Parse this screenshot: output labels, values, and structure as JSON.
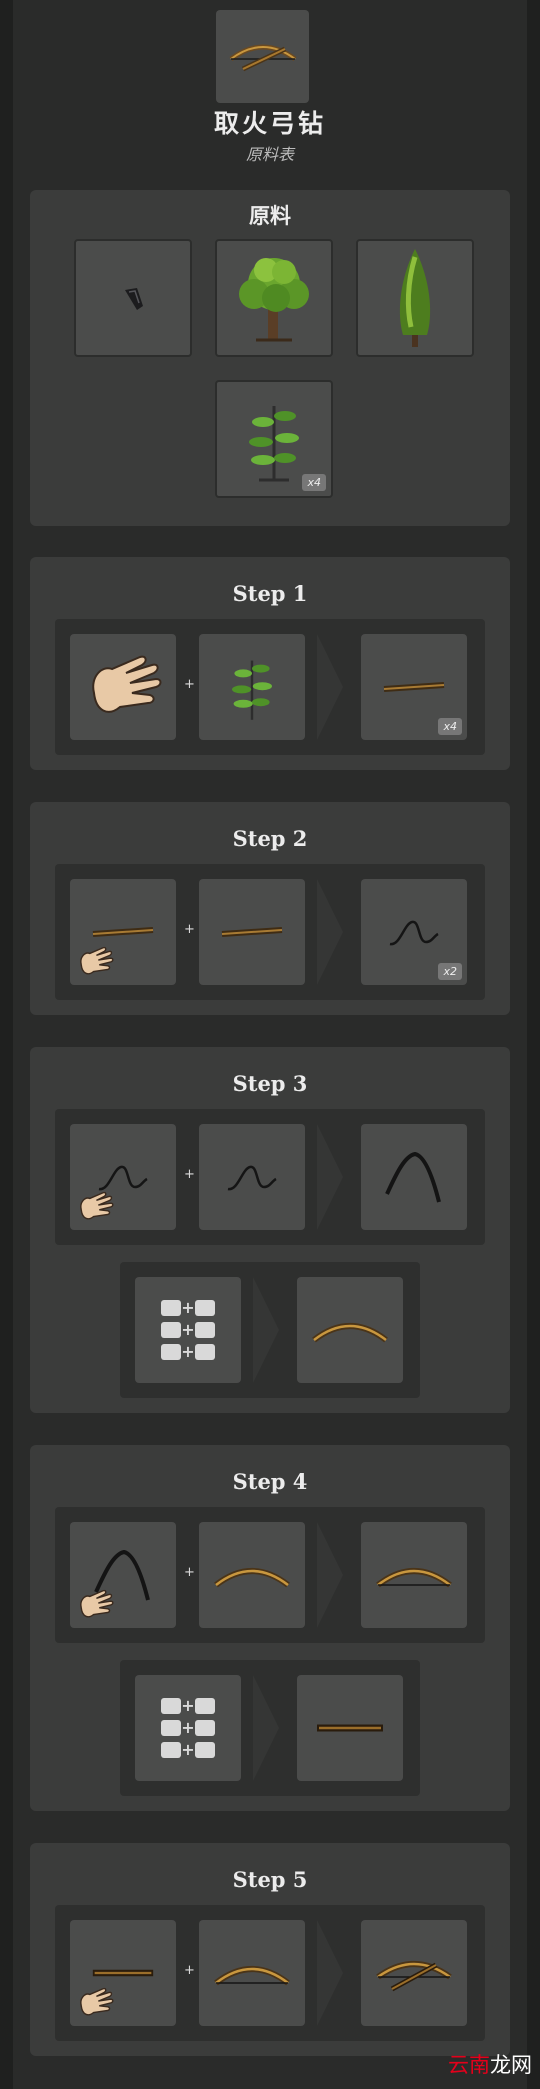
{
  "header": {
    "title": "取火弓钻",
    "subtitle": "原料表"
  },
  "materials": {
    "title": "原料",
    "items": [
      {
        "name": "flint",
        "badge": ""
      },
      {
        "name": "birchnut-tree",
        "badge": ""
      },
      {
        "name": "evergreen-tree",
        "badge": ""
      },
      {
        "name": "sapling",
        "badge": "x4"
      }
    ]
  },
  "steps": [
    {
      "label": "Step 1",
      "rows": [
        {
          "kind": "hand",
          "in1": "hand",
          "in2": "sapling",
          "out": "stick",
          "badge": "x4"
        }
      ]
    },
    {
      "label": "Step 2",
      "rows": [
        {
          "kind": "hand",
          "in1": "stick",
          "in2": "stick",
          "out": "string",
          "badge": "x2"
        }
      ]
    },
    {
      "label": "Step 3",
      "rows": [
        {
          "kind": "hand",
          "in1": "string",
          "in2": "string",
          "out": "bow-string",
          "badge": ""
        },
        {
          "kind": "grid",
          "out": "curved-bow",
          "badge": ""
        }
      ]
    },
    {
      "label": "Step 4",
      "rows": [
        {
          "kind": "hand",
          "in1": "bow-string",
          "in2": "curved-bow",
          "out": "strung-bow",
          "badge": ""
        },
        {
          "kind": "grid",
          "out": "drill-stick",
          "badge": ""
        }
      ]
    },
    {
      "label": "Step 5",
      "rows": [
        {
          "kind": "hand",
          "in1": "drill-stick",
          "in2": "strung-bow",
          "out": "bow-drill",
          "badge": ""
        }
      ]
    }
  ],
  "watermark": {
    "part1": "云南",
    "part2": "龙网"
  }
}
